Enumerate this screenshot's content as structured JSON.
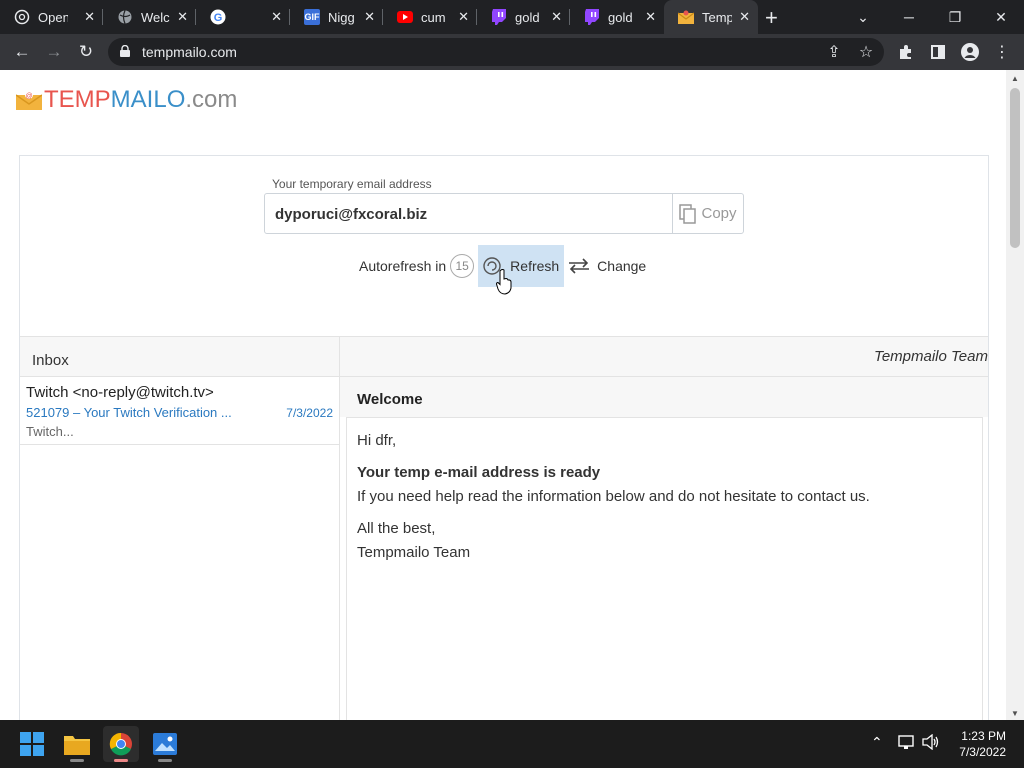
{
  "browser": {
    "tabs": [
      {
        "title": "Open",
        "icon": "openai-icon"
      },
      {
        "title": "Welc",
        "icon": "globe-icon"
      },
      {
        "title": "",
        "icon": "google-icon"
      },
      {
        "title": "Nigg",
        "icon": "gif-icon"
      },
      {
        "title": "cum",
        "icon": "youtube-icon"
      },
      {
        "title": "gold",
        "icon": "twitch-icon"
      },
      {
        "title": "gold",
        "icon": "twitch-icon"
      },
      {
        "title": "Temp",
        "icon": "tempmail-icon",
        "active": true
      }
    ],
    "url": "tempmailo.com"
  },
  "site": {
    "logo": {
      "part1": "TEMP",
      "part2": "MAILO",
      "part3": ".com"
    },
    "email_label": "Your temporary email address",
    "email_address": "dyporuci@fxcoral.biz",
    "copy_label": "Copy",
    "autorefresh_label": "Autorefresh in",
    "autorefresh_seconds": "15",
    "refresh_label": "Refresh",
    "change_label": "Change"
  },
  "inbox": {
    "title": "Inbox",
    "messages": [
      {
        "from": "Twitch <no-reply@twitch.tv>",
        "subject": "521079 – Your Twitch Verification ...",
        "date": "7/3/2022",
        "preview": "Twitch..."
      }
    ]
  },
  "reader": {
    "sender": "Tempmailo Team",
    "subject": "Welcome",
    "greeting": "Hi dfr,",
    "headline": "Your temp e-mail address is ready",
    "line1": "If you need help read the information below and do not hesitate to contact us.",
    "signoff": "All the best,",
    "signature": "Tempmailo Team"
  },
  "taskbar": {
    "time": "1:23 PM",
    "date": "7/3/2022"
  },
  "colors": {
    "accent_red": "#e8554e",
    "accent_blue": "#3a8fc9",
    "refresh_highlight": "#cfe2f3",
    "link_blue": "#2a79c0"
  }
}
